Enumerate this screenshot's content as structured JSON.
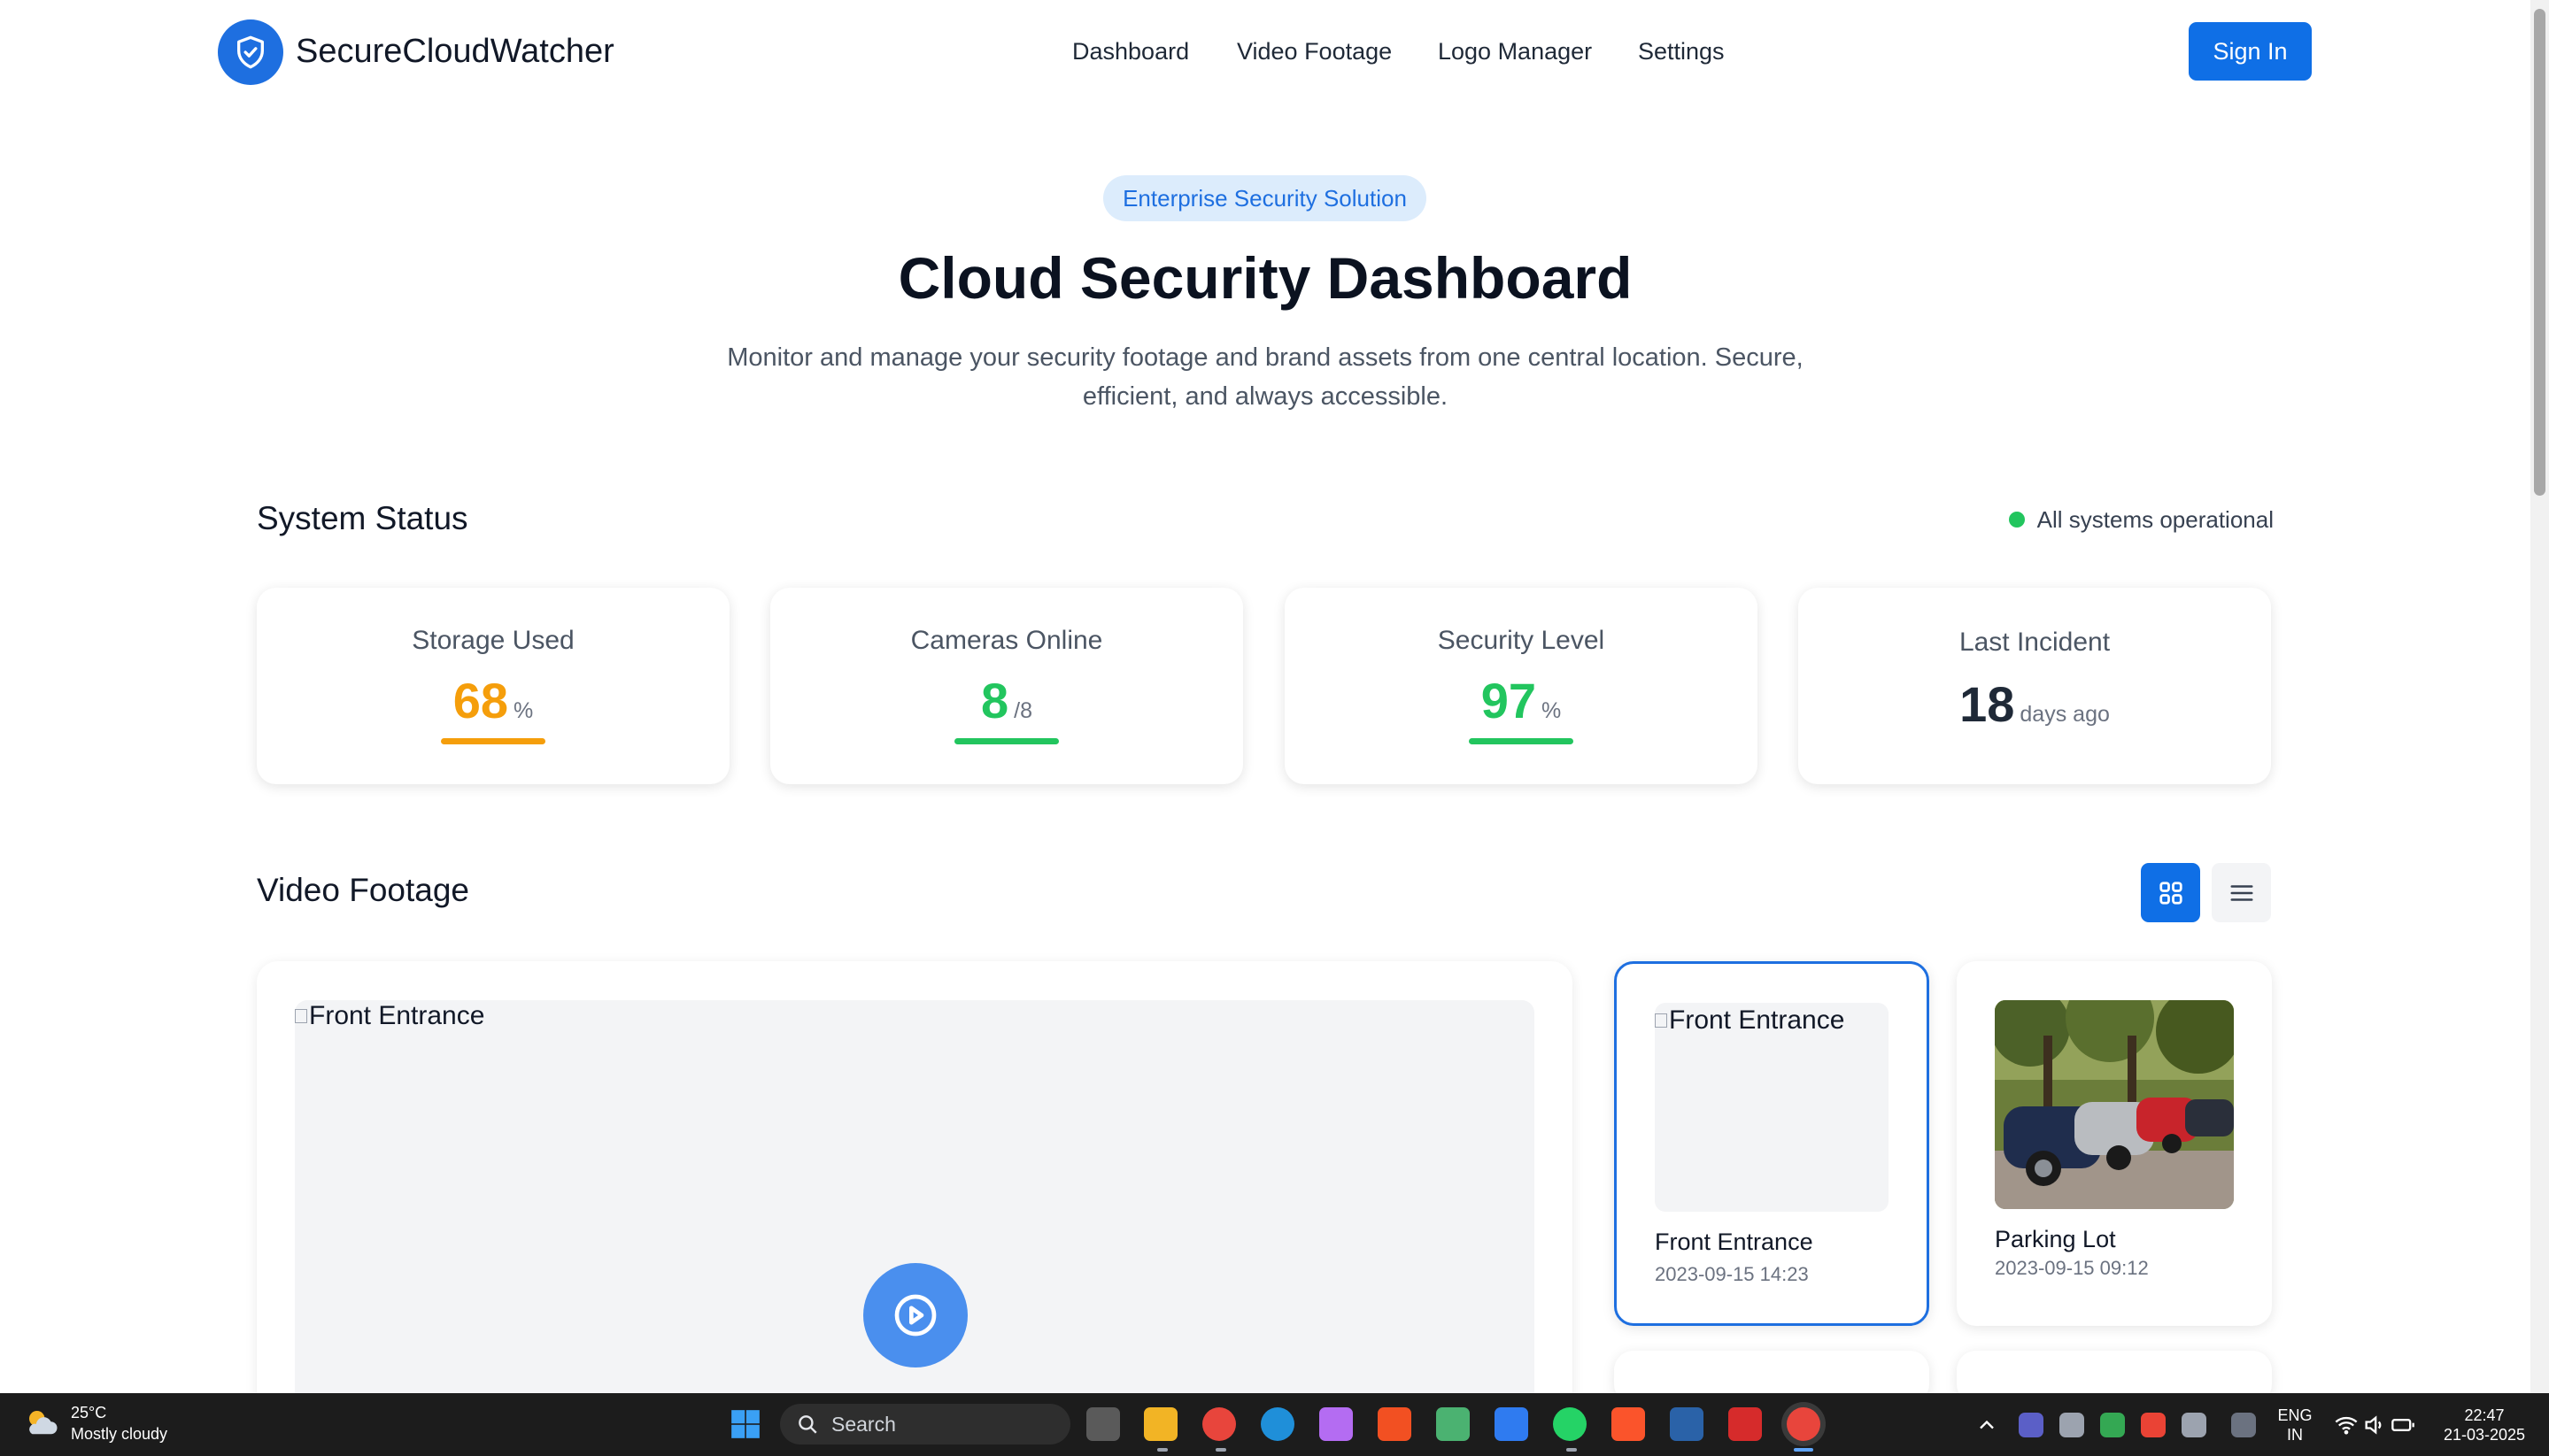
{
  "nav": {
    "brand": "SecureCloudWatcher",
    "links": [
      "Dashboard",
      "Video Footage",
      "Logo Manager",
      "Settings"
    ],
    "sign_in": "Sign In"
  },
  "hero": {
    "pill": "Enterprise Security Solution",
    "title": "Cloud Security Dashboard",
    "subtitle": "Monitor and manage your security footage and brand assets from one central location. Secure, efficient, and always accessible."
  },
  "system_status": {
    "title": "System Status",
    "status_text": "All systems operational",
    "status_color": "#22c55e",
    "cards": [
      {
        "label": "Storage Used",
        "value": "68",
        "unit": "%",
        "color": "#f59e0b",
        "progress": 0.68
      },
      {
        "label": "Cameras Online",
        "value": "8",
        "unit": "/8",
        "color": "#22c55e",
        "progress": 1.0
      },
      {
        "label": "Security Level",
        "value": "97",
        "unit": "%",
        "color": "#22c55e",
        "progress": 0.97
      },
      {
        "label": "Last Incident",
        "value": "18",
        "unit": "days ago",
        "color": "#1f2937"
      }
    ]
  },
  "video": {
    "title": "Video Footage",
    "view_modes": [
      "grid-icon",
      "list-icon"
    ],
    "active_view": "grid",
    "player_alt": "Front Entrance",
    "thumbnails": [
      {
        "title": "Front Entrance",
        "date": "2023-09-15 14:23",
        "alt": "Front Entrance",
        "active": true
      },
      {
        "title": "Parking Lot",
        "date": "2023-09-15 09:12",
        "image": "parking-lot-photo"
      }
    ]
  },
  "taskbar": {
    "temperature": "25°C",
    "weather": "Mostly cloudy",
    "search": "Search",
    "language": "ENG",
    "region": "IN",
    "time": "22:47",
    "date": "21-03-2025"
  },
  "colors": {
    "accent": "#0f6fe6",
    "warning": "#f59e0b",
    "success": "#22c55e"
  }
}
